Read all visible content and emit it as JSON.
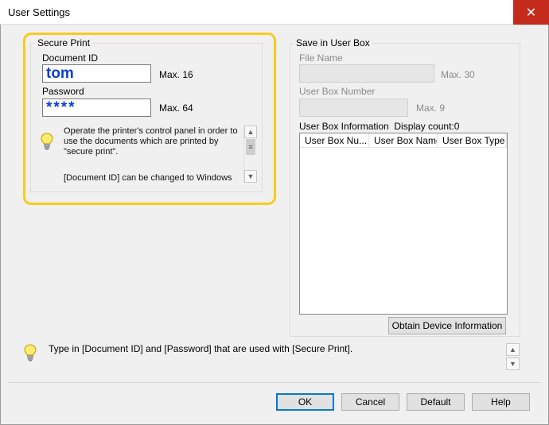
{
  "window": {
    "title": "User Settings",
    "close_glyph": "✕"
  },
  "secure_print": {
    "group_title": "Secure Print",
    "document_id_label": "Document ID",
    "document_id_value": "tom",
    "document_id_max": "Max. 16",
    "password_label": "Password",
    "password_value": "****",
    "password_max": "Max. 64",
    "info_text_1": "Operate the printer's control panel in order to use the documents which are printed by \"secure print\".",
    "info_text_2": "[Document ID] can be changed to Windows"
  },
  "user_box": {
    "group_title": "Save in User Box",
    "file_name_label": "File Name",
    "file_name_max": "Max. 30",
    "box_number_label": "User Box Number",
    "box_number_max": "Max. 9",
    "info_label": "User Box Information  Display count:0",
    "columns": [
      "User Box Nu...",
      "User Box Name",
      "User Box Type"
    ],
    "obtain_button": "Obtain Device Information"
  },
  "hint": {
    "text": "Type in [Document ID] and [Password] that are used with [Secure Print]."
  },
  "buttons": {
    "ok": "OK",
    "cancel": "Cancel",
    "default": "Default",
    "help": "Help"
  },
  "colors": {
    "highlight": "#f7cc1d",
    "value_text": "#0b3fd6",
    "close_bg": "#c42b1c",
    "default_button_border": "#0078d7"
  },
  "icons": {
    "bulb": "lightbulb-icon",
    "close": "close-icon",
    "up": "scroll-up-icon",
    "down": "scroll-down-icon"
  }
}
